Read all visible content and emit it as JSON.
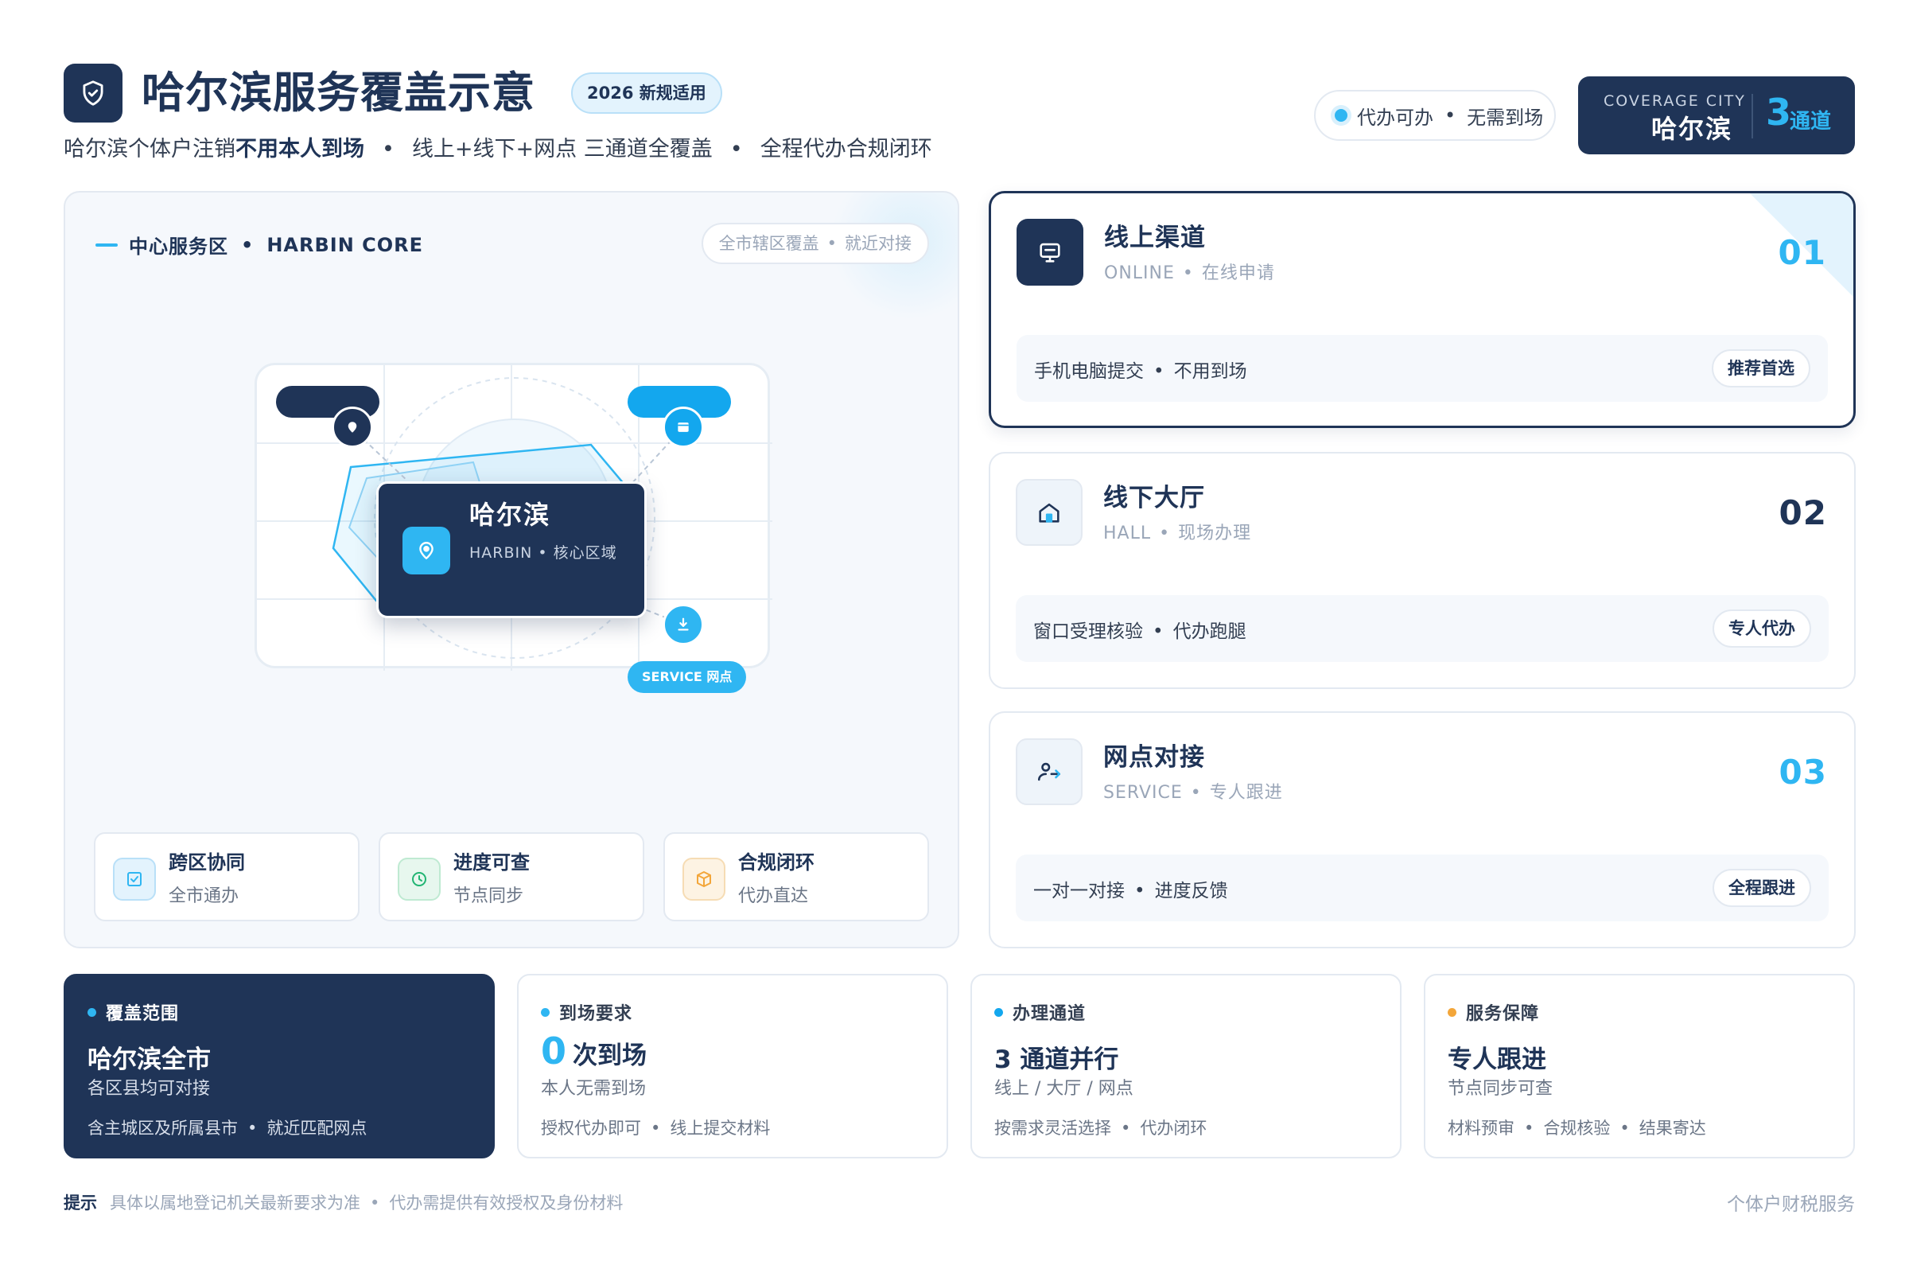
{
  "header": {
    "title": "哈尔滨服务覆盖示意",
    "badge": "2026 新规适用",
    "subtitle_pre": "哈尔滨个体户注销",
    "subtitle_bold": "不用本人到场",
    "subtitle_sep": "•",
    "subtitle_mid": "线上+线下+网点 三通道全覆盖",
    "subtitle_end": "全程代办合规闭环",
    "pill_left": "代办可办",
    "pill_sep": "•",
    "pill_right": "无需到场",
    "city_card": {
      "label": "COVERAGE CITY",
      "city": "哈尔滨",
      "count": "3",
      "unit": "通道"
    }
  },
  "left_panel": {
    "heading_zh": "中心服务区",
    "heading_sep": "•",
    "heading_en": "HARBIN CORE",
    "pill_left": "全市辖区覆盖",
    "pill_sep": "•",
    "pill_right": "就近对接",
    "map": {
      "city_name": "哈尔滨",
      "city_sub": "HARBIN • 核心区域",
      "service_tag": "SERVICE 网点"
    },
    "features": [
      {
        "title": "跨区协同",
        "sub": "全市通办",
        "icon": "check-square-icon",
        "color": "#2fb6f2"
      },
      {
        "title": "进度可查",
        "sub": "节点同步",
        "icon": "clock-icon",
        "color": "#22b573"
      },
      {
        "title": "合规闭环",
        "sub": "代办直达",
        "icon": "box-icon",
        "color": "#f3a63a"
      }
    ]
  },
  "channels": [
    {
      "name": "线上渠道",
      "en": "ONLINE",
      "en_sep": "•",
      "en_zh": "在线申请",
      "no": "01",
      "bar_left": "手机电脑提交",
      "bar_sep": "•",
      "bar_right": "不用到场",
      "button": "推荐首选",
      "icon": "monitor-icon"
    },
    {
      "name": "线下大厅",
      "en": "HALL",
      "en_sep": "•",
      "en_zh": "现场办理",
      "no": "02",
      "bar_left": "窗口受理核验",
      "bar_sep": "•",
      "bar_right": "代办跑腿",
      "button": "专人代办",
      "icon": "home-icon"
    },
    {
      "name": "网点对接",
      "en": "SERVICE",
      "en_sep": "•",
      "en_zh": "专人跟进",
      "no": "03",
      "bar_left": "一对一对接",
      "bar_sep": "•",
      "bar_right": "进度反馈",
      "button": "全程跟进",
      "icon": "user-transfer-icon"
    }
  ],
  "stats": [
    {
      "label": "覆盖范围",
      "big": "哈尔滨全市",
      "sub": "各区县均可对接",
      "foot_a": "含主城区及所属县市",
      "foot_sep": "•",
      "foot_b": "就近匹配网点",
      "dot": "#2fb6f2"
    },
    {
      "label": "到场要求",
      "big_num": "0",
      "big": "次到场",
      "sub": "本人无需到场",
      "foot_a": "授权代办即可",
      "foot_sep": "•",
      "foot_b": "线上提交材料",
      "dot": "#2fb6f2"
    },
    {
      "label": "办理通道",
      "big": "3 通道并行",
      "sub": "线上 / 大厅 / 网点",
      "foot_a": "按需求灵活选择",
      "foot_sep": "•",
      "foot_b": "代办闭环",
      "dot": "#13a7ee"
    },
    {
      "label": "服务保障",
      "big": "专人跟进",
      "sub": "节点同步可查",
      "foot_a": "材料预审",
      "foot_sep": "•",
      "foot_b": "合规核验",
      "foot_c": "结果寄达",
      "dot": "#f3a63a"
    }
  ],
  "footer": {
    "hint_label": "提示",
    "hint_a": "具体以属地登记机关最新要求为准",
    "hint_sep": "•",
    "hint_b": "代办需提供有效授权及身份材料",
    "brand": "个体户财税服务"
  }
}
